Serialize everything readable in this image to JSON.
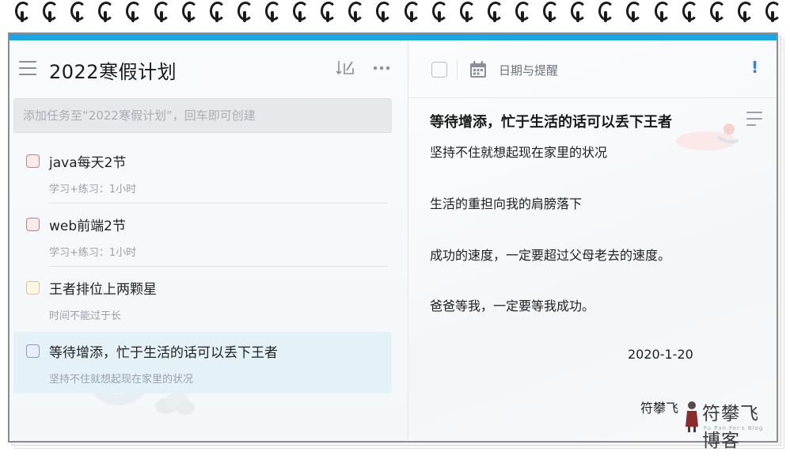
{
  "list": {
    "title": "2022寒假计划",
    "add_placeholder": "添加任务至“2022寒假计划”，回车即可创建"
  },
  "tasks": [
    {
      "title": "java每天2节",
      "note": "学习+练习：1小时",
      "priority_color": "#e0736f",
      "selected": false
    },
    {
      "title": "web前端2节",
      "note": "学习+练习：1小时",
      "priority_color": "#e0736f",
      "selected": false
    },
    {
      "title": "王者排位上两颗星",
      "note": "时间不能过于长",
      "priority_color": "#f0c65a",
      "selected": false
    },
    {
      "title": "等待增添，忙于生活的话可以丢下王者",
      "note": "坚持不住就想起现在家里的状况",
      "priority_color": "#7d9be0",
      "selected": true
    }
  ],
  "detail": {
    "date_label": "日期与提醒",
    "priority_mark": "!",
    "title": "等待增添，忙于生活的话可以丢下王者",
    "lines": [
      "坚持不住就想起现在家里的状况",
      "生活的重担向我的肩膀落下",
      "成功的速度，一定要超过父母老去的速度。",
      "爸爸等我，一定要等我成功。"
    ],
    "date": "2020-1-20",
    "signature": "符攀飞"
  },
  "watermark": {
    "text": "符攀飞博客",
    "sub": "Fu Pan Fei's Blog"
  },
  "colors": {
    "accent_bar": "#18a6e6",
    "priority_blue": "#3d7be0"
  }
}
